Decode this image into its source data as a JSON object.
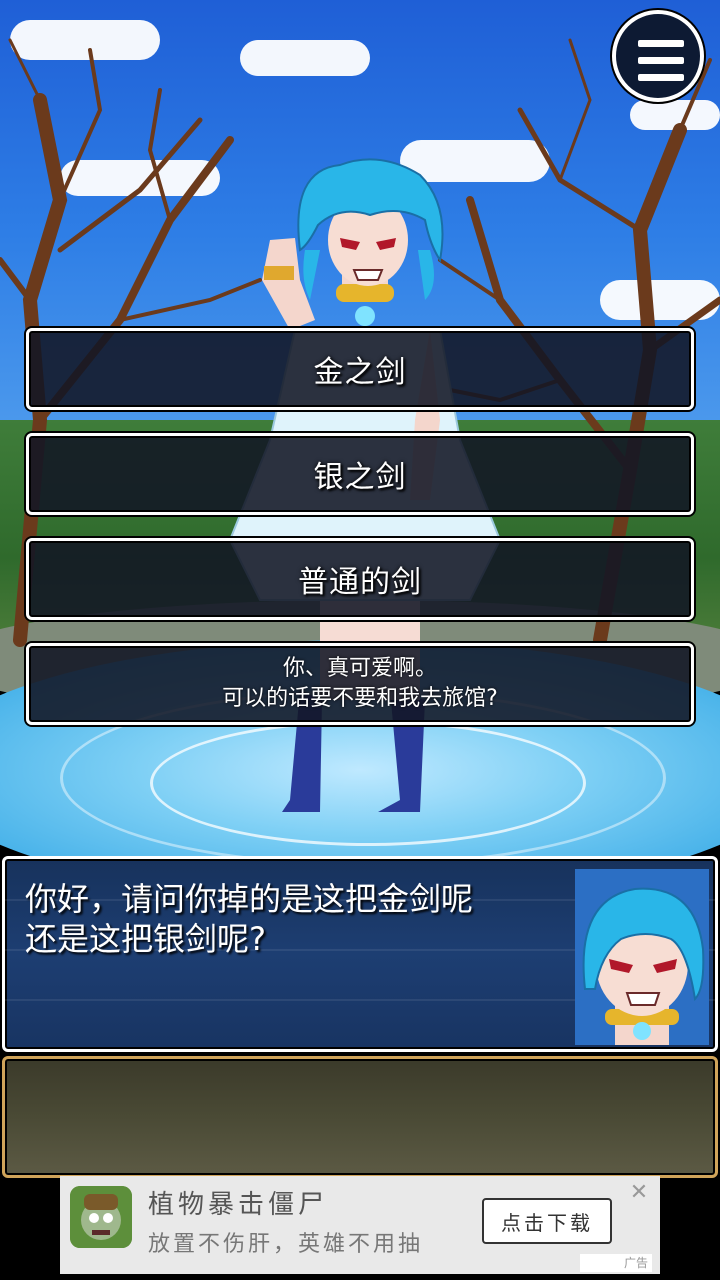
{
  "choices": [
    {
      "label": "金之剑"
    },
    {
      "label": "银之剑"
    },
    {
      "label": "普通的剑"
    },
    {
      "line1": "你、真可爱啊。",
      "line2": "可以的话要不要和我去旅馆?"
    }
  ],
  "dialogue": {
    "line1": "你好，请问你掉的是这把金剑呢",
    "line2": "还是这把银剑呢?"
  },
  "ad": {
    "title": "植物暴击僵尸",
    "description": "放置不伤肝，英雄不用抽",
    "button_label": "点击下载",
    "close_label": "✕",
    "tag": "广告"
  },
  "colors": {
    "choice_bg": "#121624",
    "dialog_bg": "#1d3e72",
    "second_box_border": "#d0a45a",
    "hair": "#29b6e8"
  },
  "icons": {
    "menu": "hamburger-menu-icon",
    "ad_close": "close-icon",
    "ad_app": "zombie-app-icon"
  }
}
